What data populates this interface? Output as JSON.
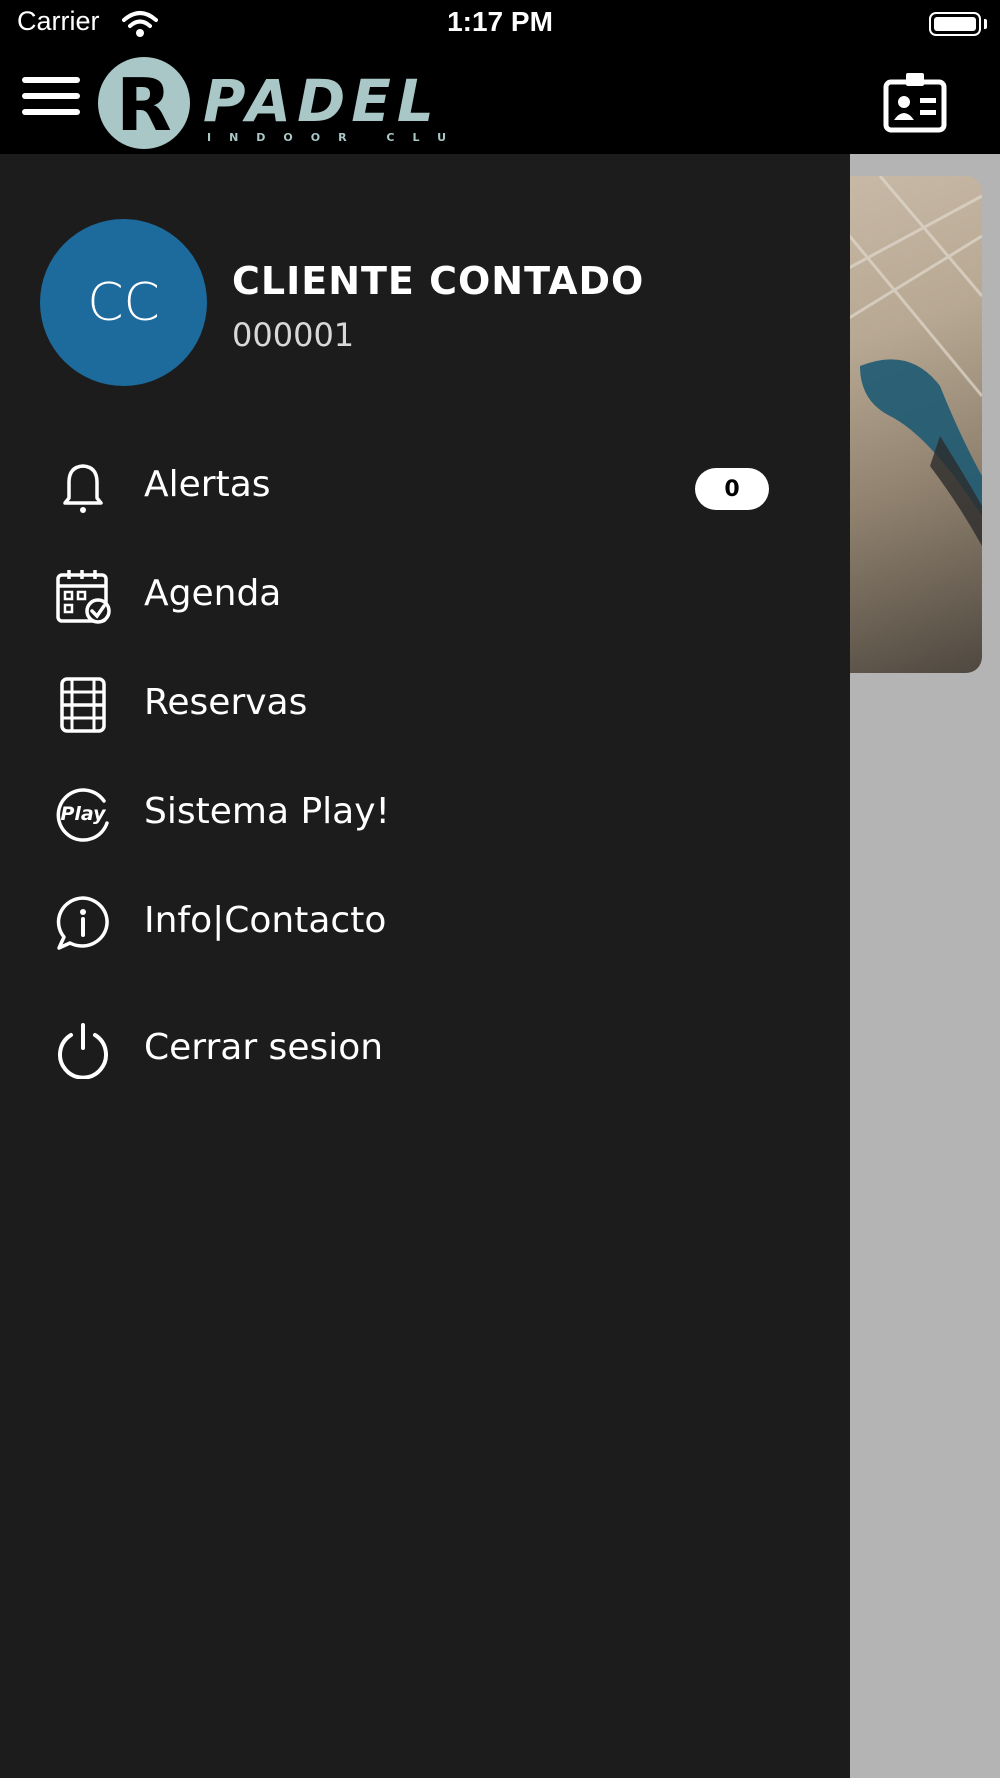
{
  "status_bar": {
    "carrier": "Carrier",
    "time": "1:17 PM"
  },
  "header": {
    "logo_letter": "R",
    "logo_text": "PADEL",
    "logo_subtext": "INDOOR CLUB"
  },
  "user": {
    "initials": "CC",
    "name": "CLIENTE CONTADO",
    "code": "000001"
  },
  "menu": {
    "items": [
      {
        "label": "Alertas",
        "icon": "bell-icon",
        "badge": "0"
      },
      {
        "label": "Agenda",
        "icon": "calendar-check-icon"
      },
      {
        "label": "Reservas",
        "icon": "court-icon"
      },
      {
        "label": "Sistema Play!",
        "icon": "play-logo-icon",
        "icon_text": "Play"
      },
      {
        "label": "Info|Contacto",
        "icon": "info-chat-icon"
      },
      {
        "label": "Cerrar sesion",
        "icon": "power-icon"
      }
    ]
  },
  "colors": {
    "avatar": "#1c6b9c",
    "drawer": "#1c1c1c",
    "logo": "#a9c7c6"
  }
}
